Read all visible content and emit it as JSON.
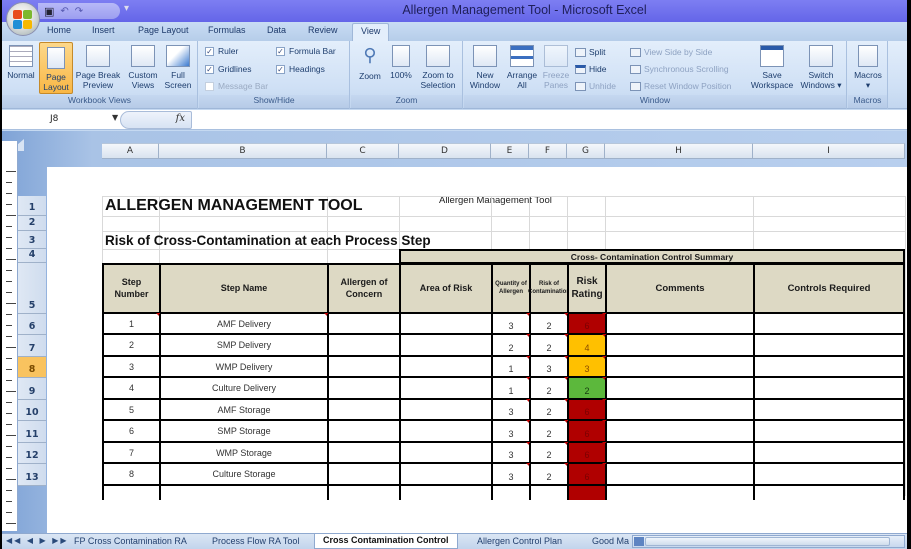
{
  "window": {
    "title": "Allergen Management Tool - Microsoft Excel",
    "qat_icons": [
      "save-icon",
      "undo-icon",
      "redo-icon"
    ]
  },
  "ribbon": {
    "tabs": [
      "Home",
      "Insert",
      "Page Layout",
      "Formulas",
      "Data",
      "Review",
      "View"
    ],
    "active_tab": "View",
    "groups": {
      "workbook_views": {
        "label": "Workbook Views",
        "buttons": [
          {
            "label": "Normal",
            "selected": false
          },
          {
            "label": "Page Layout",
            "selected": true
          },
          {
            "label": "Page Break Preview",
            "selected": false
          },
          {
            "label": "Custom Views",
            "selected": false
          },
          {
            "label": "Full Screen",
            "selected": false
          }
        ]
      },
      "show_hide": {
        "label": "Show/Hide",
        "checkboxes": [
          {
            "label": "Ruler",
            "checked": true,
            "enabled": true
          },
          {
            "label": "Formula Bar",
            "checked": true,
            "enabled": true
          },
          {
            "label": "Gridlines",
            "checked": true,
            "enabled": true
          },
          {
            "label": "Headings",
            "checked": true,
            "enabled": true
          },
          {
            "label": "Message Bar",
            "checked": false,
            "enabled": false
          }
        ]
      },
      "zoom": {
        "label": "Zoom",
        "buttons": [
          {
            "label": "Zoom"
          },
          {
            "label": "100%"
          },
          {
            "label": "Zoom to Selection"
          }
        ]
      },
      "window": {
        "label": "Window",
        "buttons": [
          {
            "label": "New Window"
          },
          {
            "label": "Arrange All"
          },
          {
            "label": "Freeze Panes",
            "enabled": false
          }
        ],
        "small_buttons": [
          {
            "label": "Split",
            "enabled": true
          },
          {
            "label": "Hide",
            "enabled": true
          },
          {
            "label": "Unhide",
            "enabled": false
          },
          {
            "label": "View Side by Side",
            "enabled": false
          },
          {
            "label": "Synchronous Scrolling",
            "enabled": false
          },
          {
            "label": "Reset Window Position",
            "enabled": false
          }
        ],
        "large_right": [
          {
            "label": "Save Workspace"
          },
          {
            "label": "Switch Windows"
          }
        ]
      },
      "macros": {
        "label": "Macros",
        "buttons": [
          {
            "label": "Macros"
          }
        ]
      }
    }
  },
  "formula_bar": {
    "name_box": "J8",
    "fx_label": "fx",
    "content": ""
  },
  "sheet": {
    "columns": [
      "A",
      "B",
      "C",
      "D",
      "E",
      "F",
      "G",
      "H",
      "I"
    ],
    "rows": [
      "1",
      "2",
      "3",
      "4",
      "5",
      "6",
      "7",
      "8",
      "9",
      "10",
      "11",
      "12",
      "13"
    ],
    "selected_row": "8",
    "page_header": "Allergen Management Tool",
    "title": "ALLERGEN MANAGEMENT TOOL",
    "subtitle": "Risk of Cross-Contamination at each Process Step",
    "summary_header": "Cross- Contamination Control Summary",
    "table_headers": [
      "Step Number",
      "Step Name",
      "Allergen of Concern",
      "Area of Risk",
      "Quantity of Allergen",
      "Risk of Contamination",
      "Risk Rating",
      "Comments",
      "Controls Required"
    ],
    "table_rows": [
      {
        "step": "1",
        "name": "AMF Delivery",
        "allergen": "",
        "area": "",
        "quantity": "3",
        "risk": "2",
        "rating": "6",
        "rating_level": "high",
        "comments": "",
        "controls": ""
      },
      {
        "step": "2",
        "name": "SMP Delivery",
        "allergen": "",
        "area": "",
        "quantity": "2",
        "risk": "2",
        "rating": "4",
        "rating_level": "medium",
        "comments": "",
        "controls": ""
      },
      {
        "step": "3",
        "name": "WMP Delivery",
        "allergen": "",
        "area": "",
        "quantity": "1",
        "risk": "3",
        "rating": "3",
        "rating_level": "medium",
        "comments": "",
        "controls": ""
      },
      {
        "step": "4",
        "name": "Culture Delivery",
        "allergen": "",
        "area": "",
        "quantity": "1",
        "risk": "2",
        "rating": "2",
        "rating_level": "low",
        "comments": "",
        "controls": ""
      },
      {
        "step": "5",
        "name": "AMF Storage",
        "allergen": "",
        "area": "",
        "quantity": "3",
        "risk": "2",
        "rating": "6",
        "rating_level": "high",
        "comments": "",
        "controls": ""
      },
      {
        "step": "6",
        "name": "SMP Storage",
        "allergen": "",
        "area": "",
        "quantity": "3",
        "risk": "2",
        "rating": "6",
        "rating_level": "high",
        "comments": "",
        "controls": ""
      },
      {
        "step": "7",
        "name": "WMP Storage",
        "allergen": "",
        "area": "",
        "quantity": "3",
        "risk": "2",
        "rating": "6",
        "rating_level": "high",
        "comments": "",
        "controls": ""
      },
      {
        "step": "8",
        "name": "Culture Storage",
        "allergen": "",
        "area": "",
        "quantity": "3",
        "risk": "2",
        "rating": "6",
        "rating_level": "high",
        "comments": "",
        "controls": ""
      }
    ],
    "rating_colors": {
      "high": "#b00000",
      "medium": "#ffc000",
      "low": "#5cb83c"
    },
    "header_fill": "#ddd9c4"
  },
  "sheet_tabs": {
    "tabs": [
      "FP Cross Contamination RA",
      "Process Flow RA Tool",
      "Cross Contamination Control",
      "Allergen Control Plan",
      "Good Ma"
    ],
    "active": "Cross Contamination Control"
  }
}
